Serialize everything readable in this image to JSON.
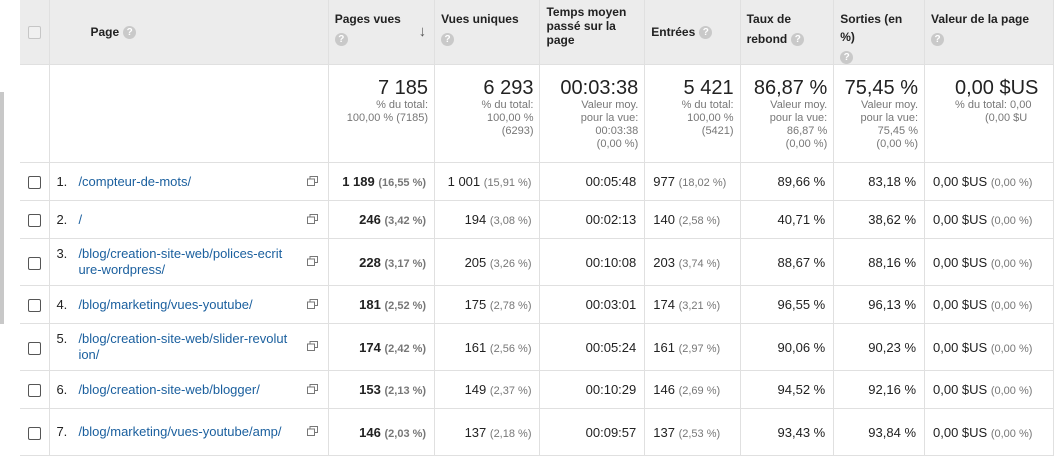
{
  "headers": {
    "page": "Page",
    "pages_vues": "Pages vues",
    "vues_uniques": "Vues uniques",
    "temps_moyen": "Temps moyen passé sur la page",
    "entrees": "Entrées",
    "taux_rebond": "Taux de rebond",
    "sorties": "Sorties (en %)",
    "valeur": "Valeur de la page",
    "help_glyph": "?",
    "sort_icon": "↓"
  },
  "totals": {
    "pages_vues": {
      "big": "7 185",
      "sub": [
        "% du total:",
        "100,00 % (7185)"
      ]
    },
    "vues_uniques": {
      "big": "6 293",
      "sub": [
        "% du total:",
        "100,00 %",
        "(6293)"
      ]
    },
    "temps_moyen": {
      "big": "00:03:38",
      "sub": [
        "Valeur moy.",
        "pour la vue:",
        "00:03:38",
        "(0,00 %)"
      ]
    },
    "entrees": {
      "big": "5 421",
      "sub": [
        "% du total:",
        "100,00 %",
        "(5421)"
      ]
    },
    "taux_rebond": {
      "big": "86,87 %",
      "sub": [
        "Valeur moy.",
        "pour la vue:",
        "86,87 %",
        "(0,00 %)"
      ]
    },
    "sorties": {
      "big": "75,45 %",
      "sub": [
        "Valeur moy.",
        "pour la vue:",
        "75,45 %",
        "(0,00 %)"
      ]
    },
    "valeur": {
      "big": "0,00 $US",
      "sub": [
        "% du total: 0,00",
        "(0,00 $U"
      ]
    }
  },
  "rows": [
    {
      "idx": "1.",
      "page": "/compteur-de-mots/",
      "pv": "1 189",
      "pv_pct": "(16,55 %)",
      "vu": "1 001",
      "vu_pct": "(15,91 %)",
      "temps": "00:05:48",
      "ent": "977",
      "ent_pct": "(18,02 %)",
      "rebond": "89,66 %",
      "sorties": "83,18 %",
      "valeur": "0,00 $US",
      "valeur_pct": "(0,00 %)"
    },
    {
      "idx": "2.",
      "page": "/",
      "pv": "246",
      "pv_pct": "(3,42 %)",
      "vu": "194",
      "vu_pct": "(3,08 %)",
      "temps": "00:02:13",
      "ent": "140",
      "ent_pct": "(2,58 %)",
      "rebond": "40,71 %",
      "sorties": "38,62 %",
      "valeur": "0,00 $US",
      "valeur_pct": "(0,00 %)"
    },
    {
      "idx": "3.",
      "page": "/blog/creation-site-web/polices-ecriture-wordpress/",
      "pv": "228",
      "pv_pct": "(3,17 %)",
      "vu": "205",
      "vu_pct": "(3,26 %)",
      "temps": "00:10:08",
      "ent": "203",
      "ent_pct": "(3,74 %)",
      "rebond": "88,67 %",
      "sorties": "88,16 %",
      "valeur": "0,00 $US",
      "valeur_pct": "(0,00 %)"
    },
    {
      "idx": "4.",
      "page": "/blog/marketing/vues-youtube/",
      "pv": "181",
      "pv_pct": "(2,52 %)",
      "vu": "175",
      "vu_pct": "(2,78 %)",
      "temps": "00:03:01",
      "ent": "174",
      "ent_pct": "(3,21 %)",
      "rebond": "96,55 %",
      "sorties": "96,13 %",
      "valeur": "0,00 $US",
      "valeur_pct": "(0,00 %)"
    },
    {
      "idx": "5.",
      "page": "/blog/creation-site-web/slider-revolution/",
      "pv": "174",
      "pv_pct": "(2,42 %)",
      "vu": "161",
      "vu_pct": "(2,56 %)",
      "temps": "00:05:24",
      "ent": "161",
      "ent_pct": "(2,97 %)",
      "rebond": "90,06 %",
      "sorties": "90,23 %",
      "valeur": "0,00 $US",
      "valeur_pct": "(0,00 %)"
    },
    {
      "idx": "6.",
      "page": "/blog/creation-site-web/blogger/",
      "pv": "153",
      "pv_pct": "(2,13 %)",
      "vu": "149",
      "vu_pct": "(2,37 %)",
      "temps": "00:10:29",
      "ent": "146",
      "ent_pct": "(2,69 %)",
      "rebond": "94,52 %",
      "sorties": "92,16 %",
      "valeur": "0,00 $US",
      "valeur_pct": "(0,00 %)"
    },
    {
      "idx": "7.",
      "page": "/blog/marketing/vues-youtube/amp/",
      "pv": "146",
      "pv_pct": "(2,03 %)",
      "vu": "137",
      "vu_pct": "(2,18 %)",
      "temps": "00:09:57",
      "ent": "137",
      "ent_pct": "(2,53 %)",
      "rebond": "93,43 %",
      "sorties": "93,84 %",
      "valeur": "0,00 $US",
      "valeur_pct": "(0,00 %)"
    }
  ]
}
